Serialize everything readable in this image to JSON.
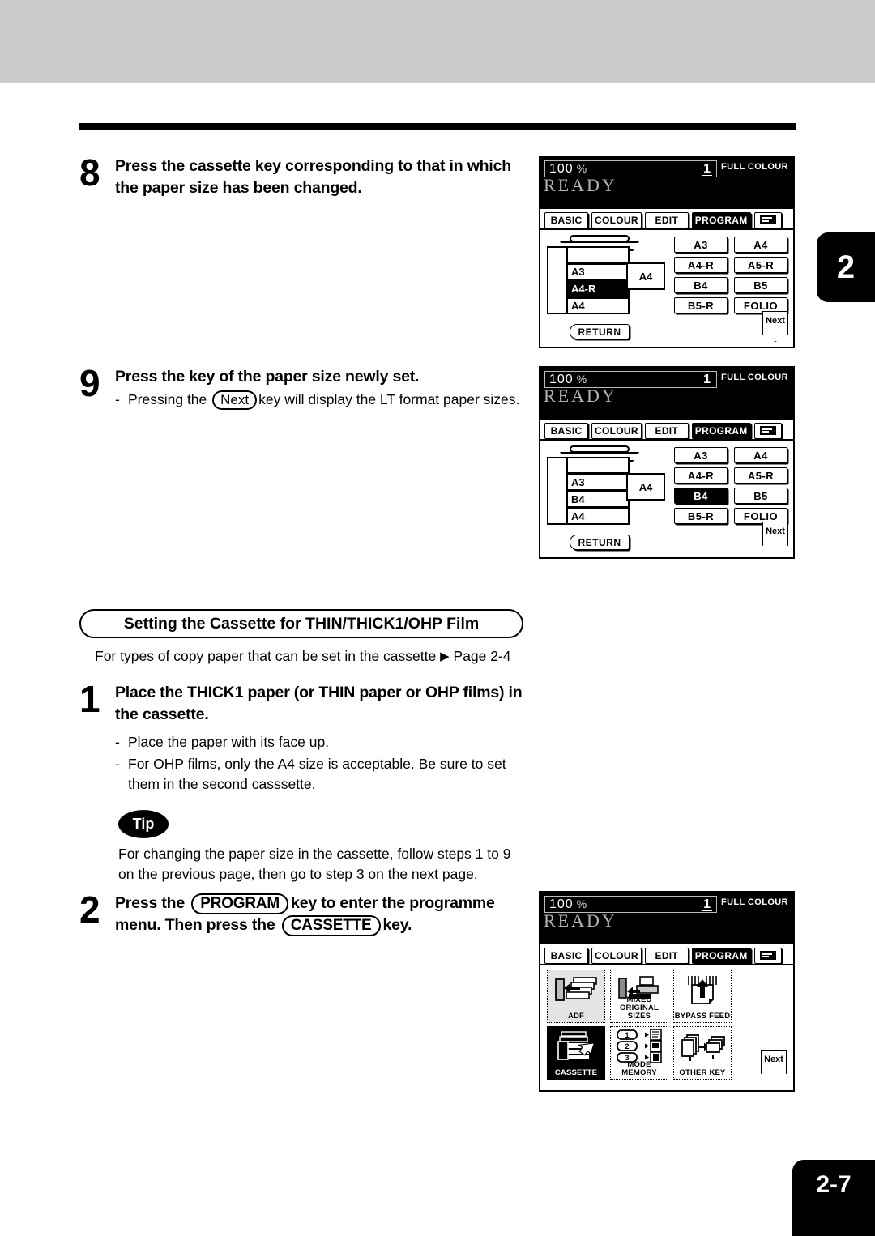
{
  "page": {
    "chapter_tab": "2",
    "page_number": "2-7"
  },
  "steps": [
    {
      "number": "8",
      "title": "Press the cassette key corresponding to that in which the paper size has been changed."
    },
    {
      "number": "9",
      "title": "Press the key of the paper size newly set.",
      "sub_pre": "Pressing the",
      "sub_key": "Next",
      "sub_post": "key will display the LT format paper sizes.",
      "dash": "-"
    },
    {
      "number": "1",
      "title": "Place the THICK1 paper (or THIN paper or OHP films) in the cassette.",
      "bullets": [
        "Place the paper with its face up.",
        "For OHP films, only the A4 size is acceptable.  Be sure to set them in the second casssette."
      ],
      "dash": "-"
    },
    {
      "number": "2",
      "title_1": "Press the",
      "key_1": "PROGRAM",
      "title_2": "key to enter the programme",
      "title_3": "menu.  Then press the",
      "key_2": "CASSETTE",
      "title_4": "key."
    }
  ],
  "section": {
    "heading": "Setting the Cassette for THIN/THICK1/OHP Film",
    "note_pre": "For types of copy paper that can be set in the cassette",
    "note_arrow": "▶",
    "note_post": "Page 2-4"
  },
  "tip": {
    "badge": "Tip",
    "line1": "For changing the paper size in the cassette, follow steps 1 to 9",
    "line2": "on the previous page, then go to step 3 on the next page."
  },
  "lcd_common": {
    "zoom": "100",
    "percent": "%",
    "count": "1",
    "colour_mode": "FULL COLOUR",
    "status": "READY",
    "tabs": [
      {
        "label": "BASIC",
        "selected": false
      },
      {
        "label": "COLOUR",
        "selected": false
      },
      {
        "label": "EDIT",
        "selected": false
      },
      {
        "label": "PROGRAM",
        "selected": true
      }
    ],
    "keyboard_tab_icon": "keyboard-icon",
    "return_label": "RETURN",
    "next_label": "Next"
  },
  "lcd_panel_1": {
    "cassette_rows": [
      {
        "label": "",
        "highlight": false
      },
      {
        "label": "A3",
        "highlight": false
      },
      {
        "label": "A4-R",
        "highlight": true
      },
      {
        "label": "A4",
        "highlight": false
      }
    ],
    "side_tray": "A4",
    "size_buttons": [
      {
        "label": "A3",
        "selected": false
      },
      {
        "label": "A4",
        "selected": false
      },
      {
        "label": "A4-R",
        "selected": false
      },
      {
        "label": "A5-R",
        "selected": false
      },
      {
        "label": "B4",
        "selected": false
      },
      {
        "label": "B5",
        "selected": false
      },
      {
        "label": "B5-R",
        "selected": false
      },
      {
        "label": "FOLIO",
        "selected": false
      }
    ]
  },
  "lcd_panel_2": {
    "cassette_rows": [
      {
        "label": "",
        "highlight": false
      },
      {
        "label": "A3",
        "highlight": false
      },
      {
        "label": "B4",
        "highlight": false
      },
      {
        "label": "A4",
        "highlight": false
      }
    ],
    "side_tray": "A4",
    "size_buttons": [
      {
        "label": "A3",
        "selected": false
      },
      {
        "label": "A4",
        "selected": false
      },
      {
        "label": "A4-R",
        "selected": false
      },
      {
        "label": "A5-R",
        "selected": false
      },
      {
        "label": "B4",
        "selected": true
      },
      {
        "label": "B5",
        "selected": false
      },
      {
        "label": "B5-R",
        "selected": false
      },
      {
        "label": "FOLIO",
        "selected": false
      }
    ]
  },
  "lcd_panel_3": {
    "menu_items": [
      {
        "label": "ADF",
        "icon": "adf-icon",
        "selected": false,
        "shaded": true
      },
      {
        "label": "MIXED\nORIGINAL SIZES",
        "label_1": "MIXED",
        "label_2": "ORIGINAL SIZES",
        "icon": "mixed-original-sizes-icon",
        "selected": false,
        "shaded": false
      },
      {
        "label": "BYPASS FEED",
        "icon": "bypass-feed-icon",
        "selected": false,
        "shaded": false
      },
      {
        "label": "CASSETTE",
        "icon": "cassette-icon",
        "selected": true,
        "shaded": false
      },
      {
        "label": "MODE MEMORY",
        "icon": "mode-memory-icon",
        "selected": false,
        "shaded": false
      },
      {
        "label": "OTHER KEY",
        "icon": "other-key-icon",
        "selected": false,
        "shaded": false
      }
    ],
    "mode_memory_numbers": [
      "1",
      "2",
      "3"
    ]
  }
}
